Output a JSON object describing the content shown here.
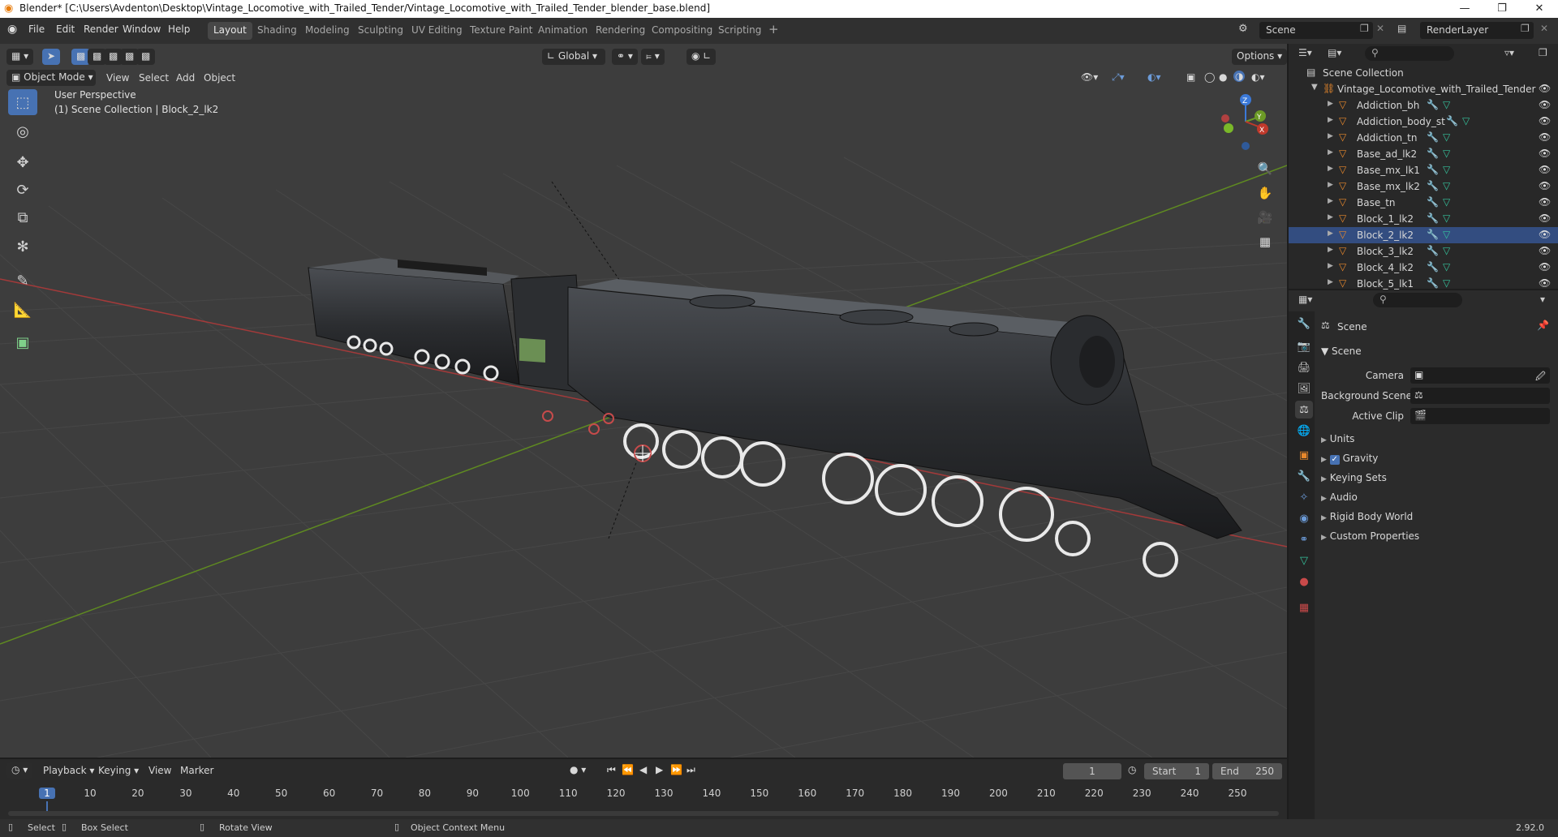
{
  "window": {
    "title": "Blender* [C:\\Users\\Avdenton\\Desktop\\Vintage_Locomotive_with_Trailed_Tender/Vintage_Locomotive_with_Trailed_Tender_blender_base.blend]",
    "minimize": "—",
    "maximize": "❐",
    "close": "✕"
  },
  "menu": {
    "items": [
      "File",
      "Edit",
      "Render",
      "Window",
      "Help"
    ],
    "workspaces": [
      "Layout",
      "Shading",
      "Modeling",
      "Sculpting",
      "UV Editing",
      "Texture Paint",
      "Animation",
      "Rendering",
      "Compositing",
      "Scripting"
    ],
    "active_workspace": "Layout",
    "add_workspace": "+",
    "scene_label": "Scene",
    "render_layer": "RenderLayer"
  },
  "viewport": {
    "mode": "Object Mode",
    "menus": [
      "View",
      "Select",
      "Add",
      "Object"
    ],
    "transform_orientation": "Global",
    "options": "Options",
    "perspective": "User Perspective",
    "collection_info": "(1) Scene Collection | Block_2_lk2",
    "gizmo": {
      "z": "Z",
      "y": "Y",
      "x": "X"
    }
  },
  "outliner": {
    "root": "Scene Collection",
    "collection": "Vintage_Locomotive_with_Trailed_Tender",
    "objects": [
      "Addiction_bh",
      "Addiction_body_st",
      "Addiction_tn",
      "Base_ad_lk2",
      "Base_mx_lk1",
      "Base_mx_lk2",
      "Base_tn",
      "Block_1_lk2",
      "Block_2_lk2",
      "Block_3_lk2",
      "Block_4_lk2",
      "Block_5_lk1"
    ],
    "selected": "Block_2_lk2"
  },
  "properties": {
    "header": "Scene",
    "section": "Scene",
    "fields": [
      {
        "label": "Camera",
        "value": ""
      },
      {
        "label": "Background Scene",
        "value": ""
      },
      {
        "label": "Active Clip",
        "value": ""
      }
    ],
    "panels": [
      "Units",
      "Gravity",
      "Keying Sets",
      "Audio",
      "Rigid Body World",
      "Custom Properties"
    ],
    "gravity_checked": true
  },
  "timeline": {
    "menus": [
      "Playback",
      "Keying",
      "View",
      "Marker"
    ],
    "current_frame": "1",
    "start_label": "Start",
    "start": "1",
    "end_label": "End",
    "end": "250",
    "ruler": [
      "1",
      "10",
      "20",
      "30",
      "40",
      "50",
      "60",
      "70",
      "80",
      "90",
      "100",
      "110",
      "120",
      "130",
      "140",
      "150",
      "160",
      "170",
      "180",
      "190",
      "200",
      "210",
      "220",
      "230",
      "240",
      "250"
    ]
  },
  "status": {
    "select": "Select",
    "box_select": "Box Select",
    "rotate_view": "Rotate View",
    "context_menu": "Object Context Menu",
    "version": "2.92.0"
  },
  "colors": {
    "accent": "#4772b3",
    "x_axis": "#c0392b",
    "y_axis": "#6c9a26",
    "z_axis": "#3b79d8",
    "object_icon": "#e8882c",
    "mesh_data": "#35c29c"
  }
}
